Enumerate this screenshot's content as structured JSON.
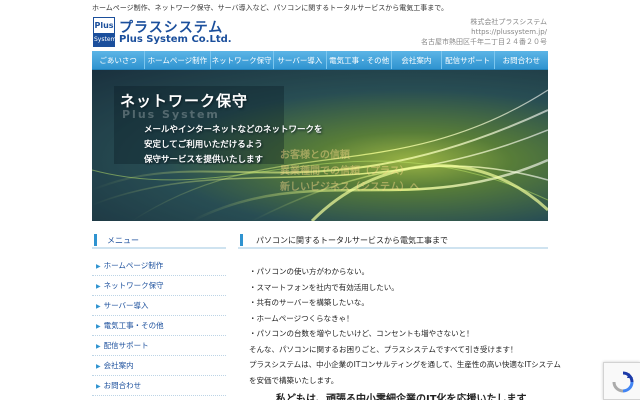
{
  "header": {
    "tagline": "ホームページ制作、ネットワーク保守、サーバ導入など、パソコンに関するトータルサービスから電気工事まで。",
    "logo": {
      "mark_top": "Plus",
      "mark_bottom": "System",
      "name_ja": "プラスシステム",
      "name_en": "Plus System Co.Ltd."
    },
    "company": {
      "name": "株式会社プラスシステム",
      "url": "https://plussystem.jp/",
      "address": "名古屋市熱田区千年二丁目２４番２０号"
    }
  },
  "nav": {
    "items": [
      "ごあいさつ",
      "ホームページ制作",
      "ネットワーク保守",
      "サーバー導入",
      "電気工事・その他",
      "会社案内",
      "配信サポート",
      "お問合わせ"
    ]
  },
  "hero": {
    "title": "ネットワーク保守",
    "lines": [
      "メールやインターネットなどのネットワークを",
      "安定してご利用いただけるよう",
      "保守サービスを提供いたします"
    ],
    "watermark": "Plus System",
    "ghost_lines": [
      "お客様との信頼",
      "異業種間での信頼（プラス）",
      "新しいビジネス（システム）へ"
    ]
  },
  "sidebar": {
    "heading": "メニュー",
    "items": [
      "ホームページ制作",
      "ネットワーク保守",
      "サーバー導入",
      "電気工事・その他",
      "配信サポート",
      "会社案内",
      "お問合わせ"
    ]
  },
  "main": {
    "heading": "パソコンに関するトータルサービスから電気工事まで",
    "paragraphs": [
      "・パソコンの使い方がわからない。",
      "・スマートフォンを社内で有効活用したい。",
      "・共有のサーバーを構築したいな。",
      "・ホームページつくらなきゃ！",
      "・パソコンの台数を増やしたいけど、コンセントも増やさないと！",
      "そんな、パソコンに関するお困りごと、プラスシステムですべて引き受けます！",
      "プラスシステムは、中小企業のITコンサルティングを通して、生産性の高い快適なITシステム",
      "を安価で構築いたします。"
    ],
    "big_text": "私どもは、頑張る中小零細企業のIT化を応援いたします"
  },
  "colors": {
    "brand": "#1b4f9c",
    "nav": "#2f93d0",
    "accent": "#2f93d0"
  },
  "icons": {
    "logo": "plus-system-logo",
    "side_arrow": "triangle-right-icon",
    "recaptcha": "recaptcha-icon"
  }
}
